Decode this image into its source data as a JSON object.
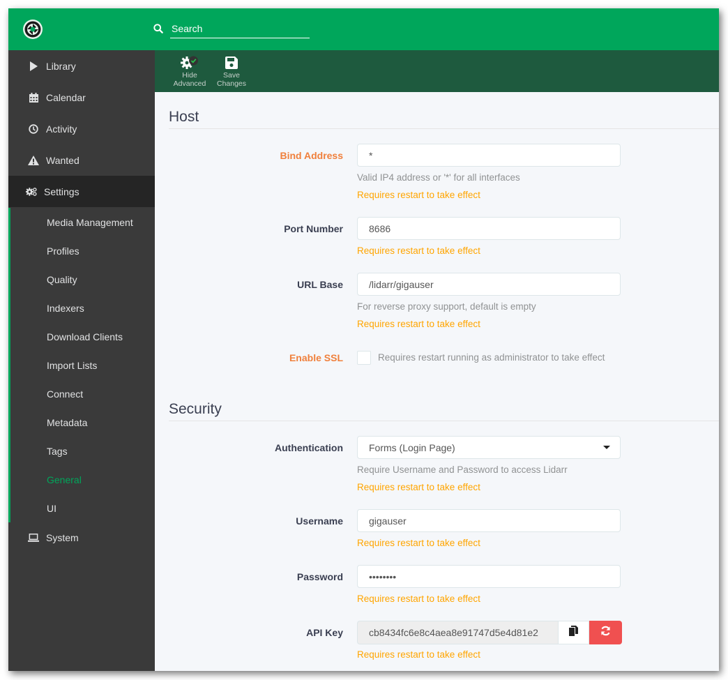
{
  "header": {
    "logo": "lidarr-logo",
    "search": {
      "icon": "search-icon",
      "placeholder": "Search",
      "value": ""
    },
    "brand_color": "#00a65b"
  },
  "sidebar": {
    "items": [
      {
        "label": "Library",
        "icon": "play-icon"
      },
      {
        "label": "Calendar",
        "icon": "calendar-icon"
      },
      {
        "label": "Activity",
        "icon": "clock-icon"
      },
      {
        "label": "Wanted",
        "icon": "warning-icon"
      },
      {
        "label": "Settings",
        "icon": "cogs-icon",
        "active": true
      },
      {
        "label": "System",
        "icon": "laptop-icon"
      }
    ],
    "settings_children": [
      {
        "label": "Media Management"
      },
      {
        "label": "Profiles"
      },
      {
        "label": "Quality"
      },
      {
        "label": "Indexers"
      },
      {
        "label": "Download Clients"
      },
      {
        "label": "Import Lists"
      },
      {
        "label": "Connect"
      },
      {
        "label": "Metadata"
      },
      {
        "label": "Tags"
      },
      {
        "label": "General",
        "current": true
      },
      {
        "label": "UI"
      }
    ]
  },
  "toolbar": {
    "hide_advanced": {
      "line1": "Hide",
      "line2": "Advanced"
    },
    "save_changes": {
      "line1": "Save",
      "line2": "Changes"
    }
  },
  "host": {
    "title": "Host",
    "bind_address": {
      "label": "Bind Address",
      "value": "*",
      "help": "Valid IP4 address or '*' for all interfaces",
      "restart": "Requires restart to take effect"
    },
    "port_number": {
      "label": "Port Number",
      "value": "8686",
      "restart": "Requires restart to take effect"
    },
    "url_base": {
      "label": "URL Base",
      "value": "/lidarr/gigauser",
      "help": "For reverse proxy support, default is empty",
      "restart": "Requires restart to take effect"
    },
    "enable_ssl": {
      "label": "Enable SSL",
      "checked": false,
      "help": "Requires restart running as administrator to take effect"
    }
  },
  "security": {
    "title": "Security",
    "authentication": {
      "label": "Authentication",
      "value": "Forms (Login Page)",
      "help": "Require Username and Password to access Lidarr",
      "restart": "Requires restart to take effect"
    },
    "username": {
      "label": "Username",
      "value": "gigauser",
      "restart": "Requires restart to take effect"
    },
    "password": {
      "label": "Password",
      "value": "gigapass",
      "restart": "Requires restart to take effect"
    },
    "api_key": {
      "label": "API Key",
      "value": "cb8434fc6e8c4aea8e91747d5e4d81e2",
      "restart": "Requires restart to take effect"
    }
  }
}
